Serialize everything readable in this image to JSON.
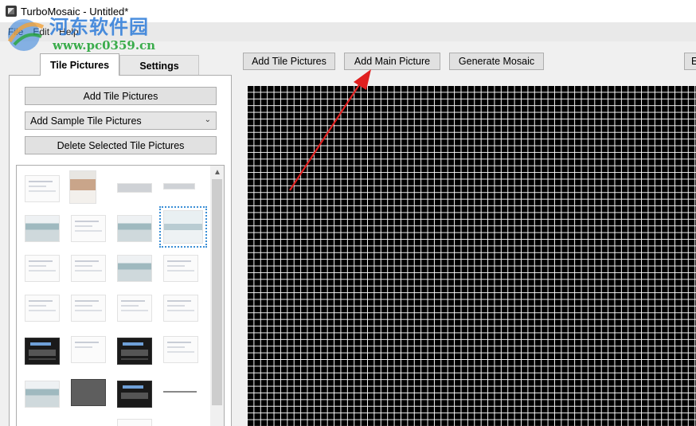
{
  "window": {
    "title": "TurboMosaic - Untitled*"
  },
  "watermark": {
    "site_name": "河东软件园",
    "url": "www.pc0359.cn"
  },
  "menu": {
    "items": [
      "File",
      "Edit",
      "Help"
    ]
  },
  "tabs": [
    {
      "label": "Tile Pictures",
      "active": true
    },
    {
      "label": "Settings",
      "active": false
    }
  ],
  "left_panel": {
    "add_tiles_label": "Add Tile Pictures",
    "sample_dropdown": {
      "selected": "Add Sample Tile Pictures"
    },
    "delete_label": "Delete Selected Tile Pictures"
  },
  "toolbar": {
    "add_tiles_label": "Add Tile Pictures",
    "add_main_label": "Add Main Picture",
    "generate_label": "Generate Mosaic",
    "cut_label": "E"
  },
  "colors": {
    "annotation_arrow": "#e02020",
    "mosaic_background": "#000000",
    "mosaic_grid": "#ffffff",
    "selection_outline": "#3b8fd6"
  }
}
